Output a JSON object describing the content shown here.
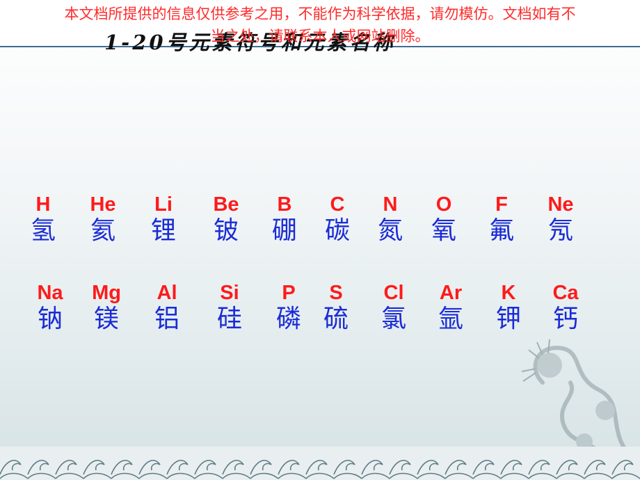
{
  "notice": "本文档所提供的信息仅供参考之用，不能作为科学依据，请勿模仿。文档如有不\n当之处，请联系本人或网站删除。",
  "title": "1-20号元素符号和元素名称",
  "rows": [
    {
      "elements": [
        {
          "symbol": "H",
          "name": "氢"
        },
        {
          "symbol": "He",
          "name": "氦"
        },
        {
          "symbol": "Li",
          "name": "锂"
        },
        {
          "symbol": "Be",
          "name": "铍"
        },
        {
          "symbol": "B",
          "name": "硼"
        },
        {
          "symbol": "C",
          "name": "碳"
        },
        {
          "symbol": "N",
          "name": "氮"
        },
        {
          "symbol": "O",
          "name": "氧"
        },
        {
          "symbol": "F",
          "name": "氟"
        },
        {
          "symbol": "Ne",
          "name": "氖"
        }
      ]
    },
    {
      "elements": [
        {
          "symbol": "Na",
          "name": "钠"
        },
        {
          "symbol": "Mg",
          "name": "镁"
        },
        {
          "symbol": "Al",
          "name": "铝"
        },
        {
          "symbol": "Si",
          "name": "硅"
        },
        {
          "symbol": "P",
          "name": "磷"
        },
        {
          "symbol": "S",
          "name": "硫"
        },
        {
          "symbol": "Cl",
          "name": "氯"
        },
        {
          "symbol": "Ar",
          "name": "氩"
        },
        {
          "symbol": "K",
          "name": "钾"
        },
        {
          "symbol": "Ca",
          "name": "钙"
        }
      ]
    }
  ],
  "colors": {
    "symbol": "#ff1a1a",
    "name": "#1a2bd6",
    "notice": "#ff2a2a",
    "border": "#3c6d8f"
  },
  "decorations": {
    "corner": "dragon-illustration",
    "bottom": "wave-pattern"
  }
}
